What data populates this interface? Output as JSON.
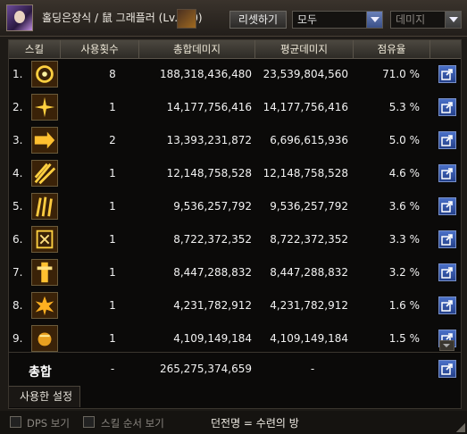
{
  "header": {
    "title": "홀딩은장식 / 鼠 그래플러 (Lv.110)",
    "reset_label": "리셋하기",
    "filter1": "모두",
    "filter2": "데미지"
  },
  "table": {
    "headers": [
      "스킬",
      "사용횟수",
      "총합데미지",
      "평균데미지",
      "점유율"
    ],
    "rows": [
      {
        "rank": "1.",
        "icon": "spiral-skill-icon",
        "count": "8",
        "total": "188,318,436,480",
        "avg": "23,539,804,560",
        "pct": "71.0 %"
      },
      {
        "rank": "2.",
        "icon": "star-burst-skill-icon",
        "count": "1",
        "total": "14,177,756,416",
        "avg": "14,177,756,416",
        "pct": "5.3 %"
      },
      {
        "rank": "3.",
        "icon": "arrow-dash-skill-icon",
        "count": "2",
        "total": "13,393,231,872",
        "avg": "6,696,615,936",
        "pct": "5.0 %"
      },
      {
        "rank": "4.",
        "icon": "slash-skill-icon",
        "count": "1",
        "total": "12,148,758,528",
        "avg": "12,148,758,528",
        "pct": "4.6 %"
      },
      {
        "rank": "5.",
        "icon": "claw-skill-icon",
        "count": "1",
        "total": "9,536,257,792",
        "avg": "9,536,257,792",
        "pct": "3.6 %"
      },
      {
        "rank": "6.",
        "icon": "rune-skill-icon",
        "count": "1",
        "total": "8,722,372,352",
        "avg": "8,722,372,352",
        "pct": "3.3 %"
      },
      {
        "rank": "7.",
        "icon": "pillar-skill-icon",
        "count": "1",
        "total": "8,447,288,832",
        "avg": "8,447,288,832",
        "pct": "3.2 %"
      },
      {
        "rank": "8.",
        "icon": "explosion-skill-icon",
        "count": "1",
        "total": "4,231,782,912",
        "avg": "4,231,782,912",
        "pct": "1.6 %"
      },
      {
        "rank": "9.",
        "icon": "fist-skill-icon",
        "count": "1",
        "total": "4,109,149,184",
        "avg": "4,109,149,184",
        "pct": "1.5 %"
      }
    ],
    "total": {
      "label": "총합",
      "count": "-",
      "total": "265,275,374,659",
      "avg": "-"
    },
    "settings_tab": "사용한 설정"
  },
  "bottom": {
    "dps_label": "DPS 보기",
    "order_label": "스킬 순서 보기",
    "dungeon": "던전명 = 수련의 방"
  },
  "colors": {
    "share_button": "#3a5ca8",
    "icon_gold": "#e8b020"
  }
}
